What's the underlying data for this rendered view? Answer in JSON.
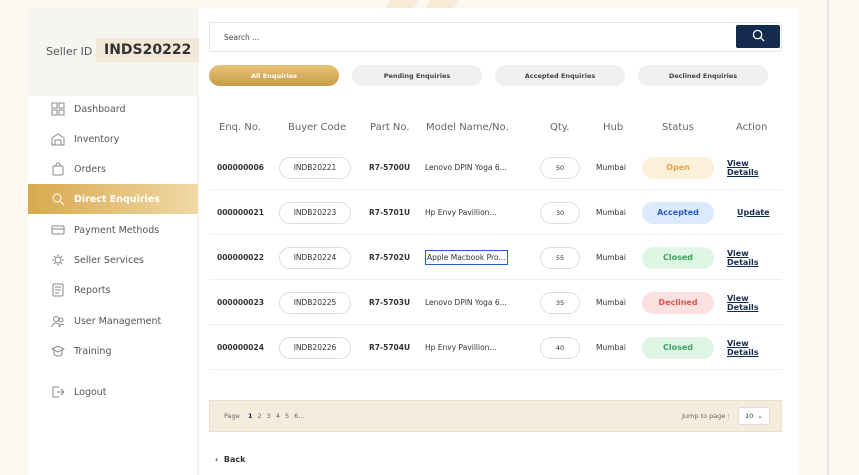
{
  "seller": {
    "label": "Seller ID",
    "id": "INDS20222"
  },
  "nav": [
    {
      "label": "Dashboard",
      "icon": "dashboard-icon"
    },
    {
      "label": "Inventory",
      "icon": "inventory-icon"
    },
    {
      "label": "Orders",
      "icon": "orders-icon"
    },
    {
      "label": "Direct Enquiries",
      "icon": "direct-enquiries-icon",
      "active": true
    },
    {
      "label": "Payment Methods",
      "icon": "payment-icon"
    },
    {
      "label": "Seller Services",
      "icon": "seller-services-icon"
    },
    {
      "label": "Reports",
      "icon": "reports-icon"
    },
    {
      "label": "User Management",
      "icon": "user-management-icon"
    },
    {
      "label": "Training",
      "icon": "training-icon"
    },
    {
      "label": "Logout",
      "icon": "logout-icon"
    }
  ],
  "search": {
    "placeholder": "Search ..."
  },
  "tabs": [
    {
      "label": "All Enquiries",
      "active": true
    },
    {
      "label": "Pending Enquiries"
    },
    {
      "label": "Accepted Enquiries"
    },
    {
      "label": "Declined Enquiries"
    }
  ],
  "table": {
    "headers": [
      "Enq. No.",
      "Buyer Code",
      "Part No.",
      "Model Name/No.",
      "Qty.",
      "Hub",
      "Status",
      "Action"
    ],
    "rows": [
      {
        "enq": "000000006",
        "buyer": "INDB20221",
        "part": "R7-5700U",
        "model": "Lenovo DPIN Yoga 6...",
        "qty": "50",
        "hub": "Mumbai",
        "status": "Open",
        "action": "View Details"
      },
      {
        "enq": "000000021",
        "buyer": "INDB20223",
        "part": "R7-5701U",
        "model": "Hp Envy Pavillion...",
        "qty": "30",
        "hub": "Mumbai",
        "status": "Accepted",
        "action": "Update"
      },
      {
        "enq": "000000022",
        "buyer": "INDB20224",
        "part": "R7-5702U",
        "model": "Apple Macbook Pro...",
        "qty": "55",
        "hub": "Mumbai",
        "status": "Closed",
        "action": "View Details",
        "selected": true
      },
      {
        "enq": "000000023",
        "buyer": "INDB20225",
        "part": "R7-5703U",
        "model": "Lenovo DPIN Yoga 6...",
        "qty": "35",
        "hub": "Mumbai",
        "status": "Declined",
        "action": "View Details"
      },
      {
        "enq": "000000024",
        "buyer": "INDB20226",
        "part": "R7-5704U",
        "model": "Hp Envy Pavillion...",
        "qty": "40",
        "hub": "Mumbai",
        "status": "Closed",
        "action": "View Details"
      }
    ]
  },
  "status_colors": {
    "Open": {
      "bg": "#fdf0d8",
      "fg": "#e0a450"
    },
    "Accepted": {
      "bg": "#dbeafd",
      "fg": "#2a5cc7"
    },
    "Closed": {
      "bg": "#dff5e6",
      "fg": "#3aa55b"
    },
    "Declined": {
      "bg": "#fde0e0",
      "fg": "#d9534f"
    }
  },
  "pagination": {
    "label": "Page",
    "pages": [
      "1",
      "2",
      "3",
      "4",
      "5",
      "6..."
    ],
    "current": "1",
    "jump_label": "Jump to page :",
    "jump_value": "10"
  },
  "back_label": "Back"
}
